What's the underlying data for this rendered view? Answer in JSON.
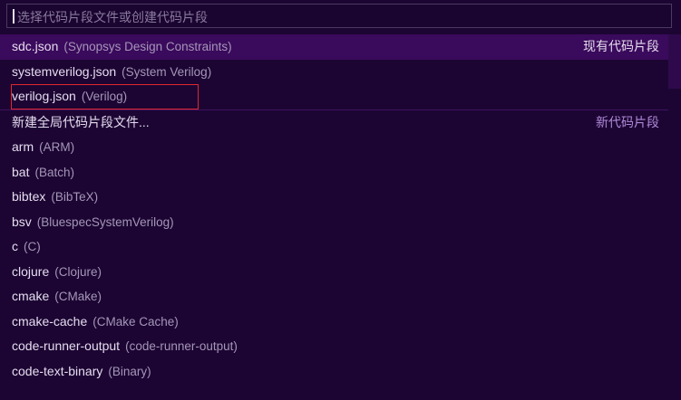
{
  "search": {
    "placeholder": "选择代码片段文件或创建代码片段",
    "value": ""
  },
  "existing_group": "现有代码片段",
  "new_group": "新代码片段",
  "existing": [
    {
      "label": "sdc.json",
      "desc": "(Synopsys Design Constraints)"
    },
    {
      "label": "systemverilog.json",
      "desc": "(System Verilog)"
    },
    {
      "label": "verilog.json",
      "desc": "(Verilog)"
    }
  ],
  "new_global": "新建全局代码片段文件...",
  "languages": [
    {
      "label": "arm",
      "desc": "(ARM)"
    },
    {
      "label": "bat",
      "desc": "(Batch)"
    },
    {
      "label": "bibtex",
      "desc": "(BibTeX)"
    },
    {
      "label": "bsv",
      "desc": "(BluespecSystemVerilog)"
    },
    {
      "label": "c",
      "desc": "(C)"
    },
    {
      "label": "clojure",
      "desc": "(Clojure)"
    },
    {
      "label": "cmake",
      "desc": "(CMake)"
    },
    {
      "label": "cmake-cache",
      "desc": "(CMake Cache)"
    },
    {
      "label": "code-runner-output",
      "desc": "(code-runner-output)"
    },
    {
      "label": "code-text-binary",
      "desc": "(Binary)"
    }
  ],
  "colors": {
    "background": "#1c0533",
    "selected": "#3a0a5c",
    "highlight_box": "#e0282e"
  }
}
